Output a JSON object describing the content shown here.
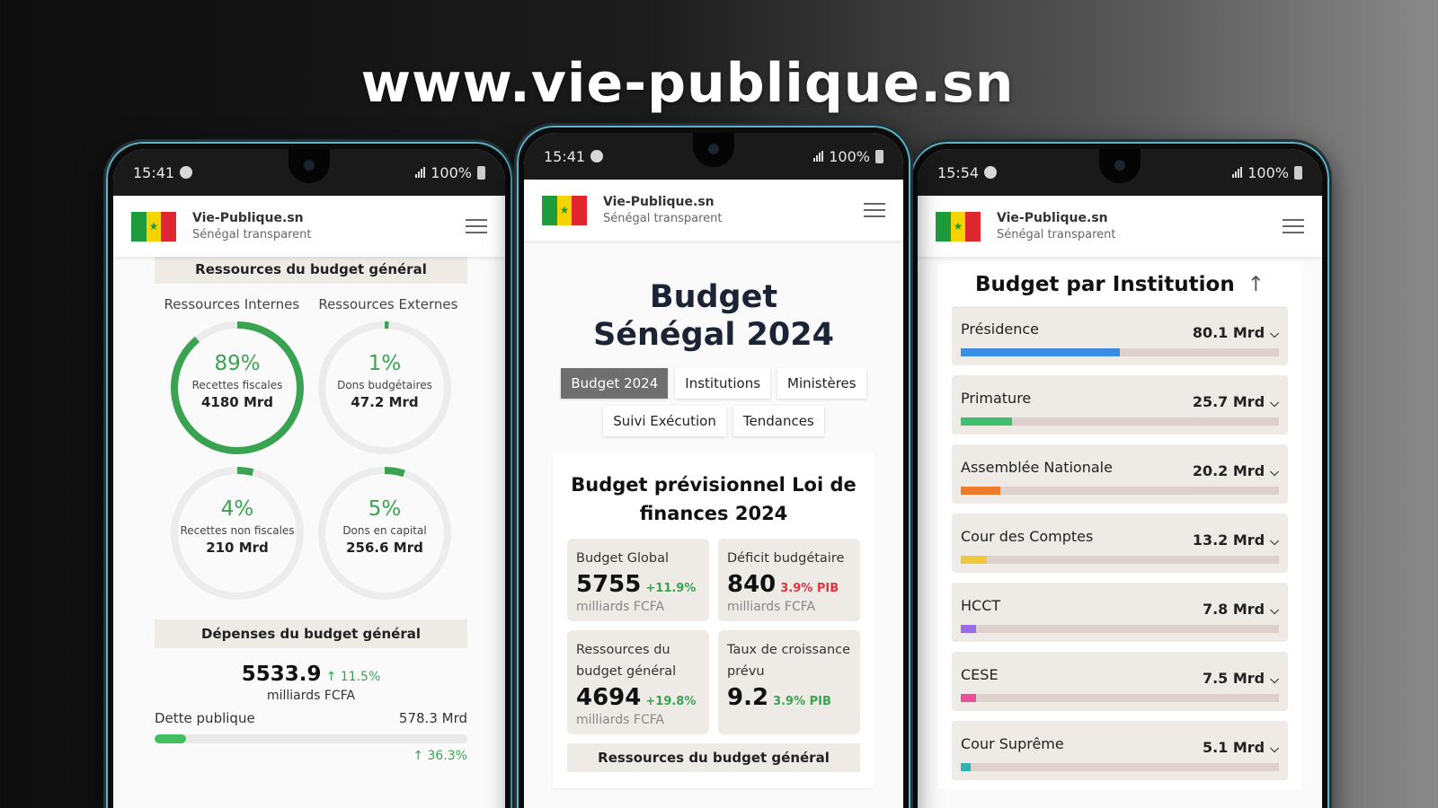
{
  "site_url": "www.vie-publique.sn",
  "app": {
    "name": "Vie-Publique.sn",
    "tagline": "Sénégal transparent",
    "colors": {
      "accent_green": "#3aa351",
      "negative_red": "#e0343f",
      "flag_green": "#1e9b3c",
      "flag_yellow": "#f7d400",
      "flag_red": "#e0262e"
    }
  },
  "phones": {
    "left": {
      "status": {
        "time": "15:41",
        "battery": "100%"
      },
      "resources": {
        "title": "Ressources du budget général",
        "col_internal": "Ressources Internes",
        "col_external": "Ressources Externes",
        "donuts": [
          {
            "pct": "89%",
            "label": "Recettes fiscales",
            "value": "4180 Mrd",
            "fraction": 0.89
          },
          {
            "pct": "1%",
            "label": "Dons budgétaires",
            "value": "47.2 Mrd",
            "fraction": 0.01
          },
          {
            "pct": "4%",
            "label": "Recettes non fiscales",
            "value": "210 Mrd",
            "fraction": 0.04
          },
          {
            "pct": "5%",
            "label": "Dons en capital",
            "value": "256.6 Mrd",
            "fraction": 0.05
          }
        ]
      },
      "expenses": {
        "title": "Dépenses du budget général",
        "total": "5533.9",
        "change": "↑ 11.5%",
        "unit": "milliards FCFA",
        "debt_label": "Dette publique",
        "debt_value": "578.3 Mrd",
        "debt_fraction": 0.1,
        "debt_change": "↑ 36.3%"
      }
    },
    "center": {
      "status": {
        "time": "15:41",
        "battery": "100%"
      },
      "hero_title": "Budget Sénégal 2024",
      "tabs": [
        "Budget 2024",
        "Institutions",
        "Ministères",
        "Suivi Exécution",
        "Tendances"
      ],
      "card_title": "Budget prévisionnel Loi de finances 2024",
      "kpis": [
        {
          "label": "Budget Global",
          "value": "5755",
          "change": "+11.9%",
          "unit": "milliards FCFA",
          "tone": "positive"
        },
        {
          "label": "Déficit budgétaire",
          "value": "840",
          "change": "3.9% PIB",
          "unit": "milliards FCFA",
          "tone": "negative"
        },
        {
          "label": "Ressources du budget général",
          "value": "4694",
          "change": "+19.8%",
          "unit": "milliards FCFA",
          "tone": "positive"
        },
        {
          "label": "Taux de croissance prévu",
          "value": "9.2",
          "change": "3.9% PIB",
          "unit": "",
          "tone": "positive"
        }
      ],
      "sub_title": "Ressources du budget général"
    },
    "right": {
      "status": {
        "time": "15:54",
        "battery": "100%"
      },
      "title": "Budget par Institution",
      "sort_icon": "↑",
      "institutions": [
        {
          "name": "Présidence",
          "amount": "80.1 Mrd",
          "fraction": 0.5,
          "color": "#3a8de0"
        },
        {
          "name": "Primature",
          "amount": "25.7 Mrd",
          "fraction": 0.16,
          "color": "#3fbf6e"
        },
        {
          "name": "Assemblée Nationale",
          "amount": "20.2 Mrd",
          "fraction": 0.125,
          "color": "#ec7c2c"
        },
        {
          "name": "Cour des Comptes",
          "amount": "13.2 Mrd",
          "fraction": 0.083,
          "color": "#f0c93a"
        },
        {
          "name": "HCCT",
          "amount": "7.8 Mrd",
          "fraction": 0.049,
          "color": "#9b6ce8"
        },
        {
          "name": "CESE",
          "amount": "7.5 Mrd",
          "fraction": 0.047,
          "color": "#ec4f9a"
        },
        {
          "name": "Cour Suprême",
          "amount": "5.1 Mrd",
          "fraction": 0.032,
          "color": "#2ab5b0"
        }
      ]
    }
  }
}
